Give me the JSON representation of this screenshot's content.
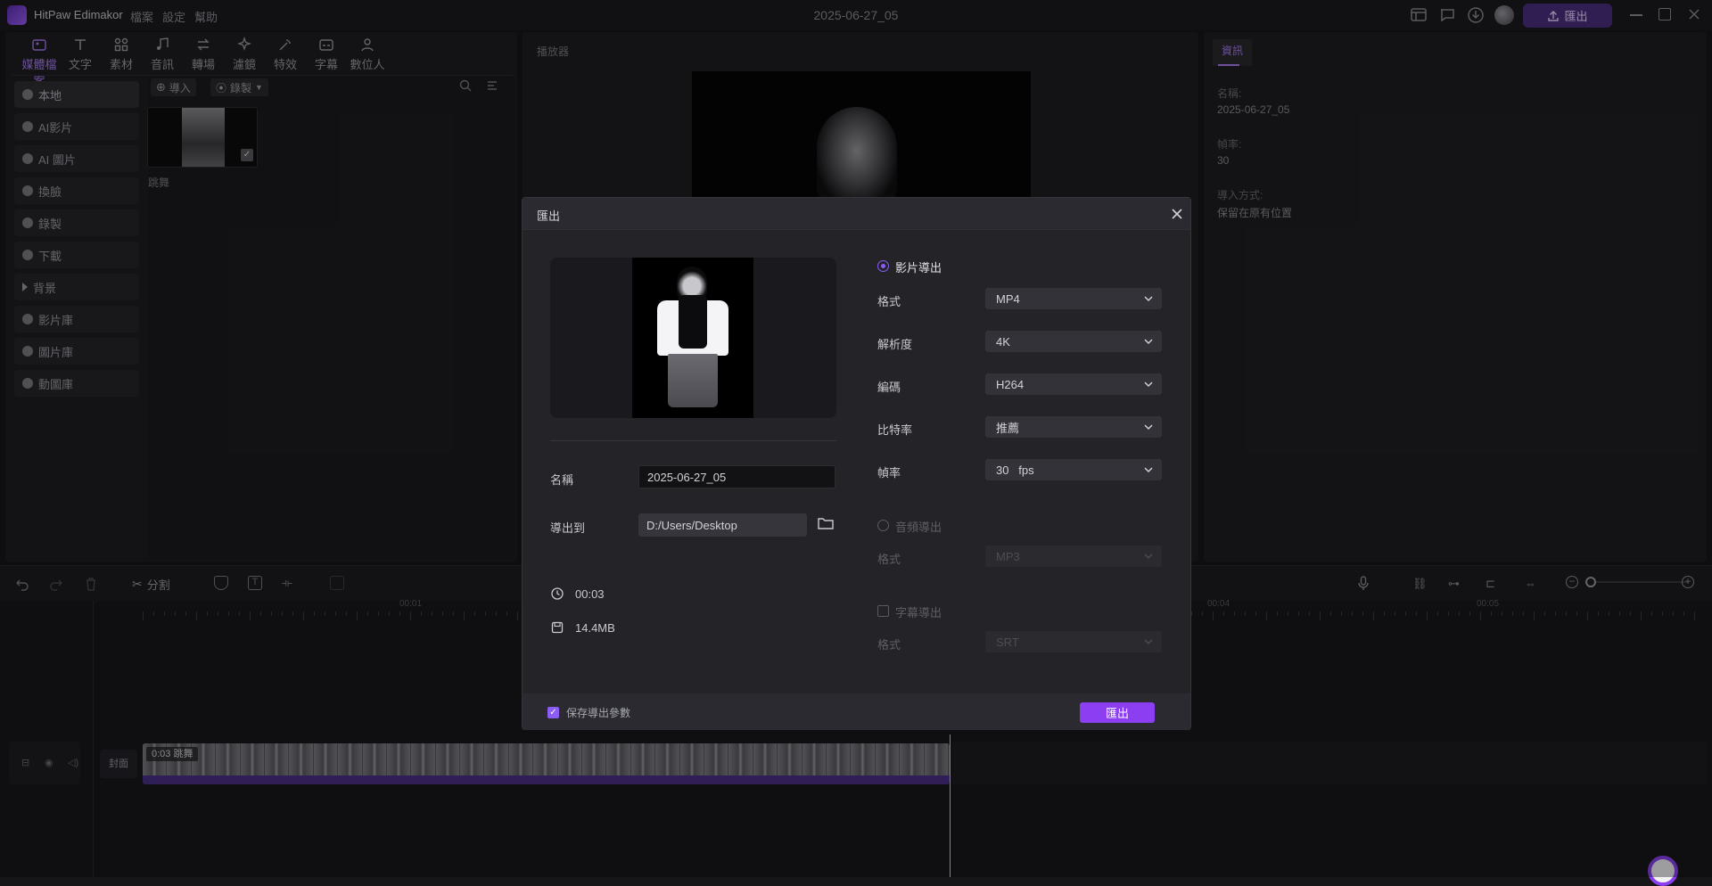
{
  "titlebar": {
    "app_name": "HitPaw Edimakor",
    "menus": [
      "檔案",
      "設定",
      "幫助"
    ],
    "document_title": "2025-06-27_05",
    "export_label": "匯出"
  },
  "toolbar_tabs": [
    {
      "label": "媒體檔案",
      "icon": "media-icon",
      "active": true
    },
    {
      "label": "文字",
      "icon": "text-icon"
    },
    {
      "label": "素材",
      "icon": "elements-icon"
    },
    {
      "label": "音訊",
      "icon": "audio-icon"
    },
    {
      "label": "轉場",
      "icon": "transition-icon"
    },
    {
      "label": "濾鏡",
      "icon": "filter-icon"
    },
    {
      "label": "特效",
      "icon": "effects-icon"
    },
    {
      "label": "字幕",
      "icon": "subtitle-icon"
    },
    {
      "label": "數位人",
      "icon": "avatar-icon"
    }
  ],
  "sidebar": {
    "items": [
      {
        "label": "本地",
        "icon": "folder-icon",
        "active": true
      },
      {
        "label": "AI影片",
        "icon": "ai-video-icon"
      },
      {
        "label": "AI 圖片",
        "icon": "ai-image-icon"
      },
      {
        "label": "換臉",
        "icon": "face-swap-icon"
      },
      {
        "label": "錄製",
        "icon": "record-icon"
      },
      {
        "label": "下載",
        "icon": "download-icon"
      },
      {
        "label": "背景",
        "icon": "caret-right-icon"
      },
      {
        "label": "影片庫",
        "icon": "video-library-icon"
      },
      {
        "label": "圖片庫",
        "icon": "image-library-icon"
      },
      {
        "label": "動圖庫",
        "icon": "gif-library-icon"
      }
    ]
  },
  "media": {
    "import_label": "導入",
    "record_label": "錄製",
    "clip_name": "跳舞"
  },
  "player": {
    "title": "播放器"
  },
  "info": {
    "tab_label": "資訊",
    "name_label": "名稱:",
    "name_value": "2025-06-27_05",
    "fps_label": "幀率:",
    "fps_value": "30",
    "import_label": "導入方式:",
    "import_value": "保留在原有位置"
  },
  "timeline": {
    "split_label": "分割",
    "ruler_labels": [
      "00:01",
      "00:04",
      "00:05"
    ],
    "cover_label": "封面",
    "clip_label": "0:03  跳舞"
  },
  "export_dialog": {
    "title": "匯出",
    "name_label": "名稱",
    "name_value": "2025-06-27_05",
    "export_to_label": "導出到",
    "export_path": "D:/Users/Desktop",
    "duration": "00:03",
    "file_size": "14.4MB",
    "video_export_label": "影片導出",
    "format_label": "格式",
    "format_value": "MP4",
    "resolution_label": "解析度",
    "resolution_value": "4K",
    "encoder_label": "編碼",
    "encoder_value": "H264",
    "bitrate_label": "比特率",
    "bitrate_value": "推薦",
    "framerate_label": "幀率",
    "framerate_value": "30   fps",
    "audio_export_label": "音頻導出",
    "audio_format_label": "格式",
    "audio_format_value": "MP3",
    "subtitle_export_label": "字幕導出",
    "subtitle_format_label": "格式",
    "subtitle_format_value": "SRT",
    "save_params_label": "保存導出參數",
    "export_button": "匯出"
  },
  "colors": {
    "accent": "#8b3ff0",
    "accent_light": "#a97cf2",
    "panel": "#1e1e22",
    "background": "#161619"
  }
}
